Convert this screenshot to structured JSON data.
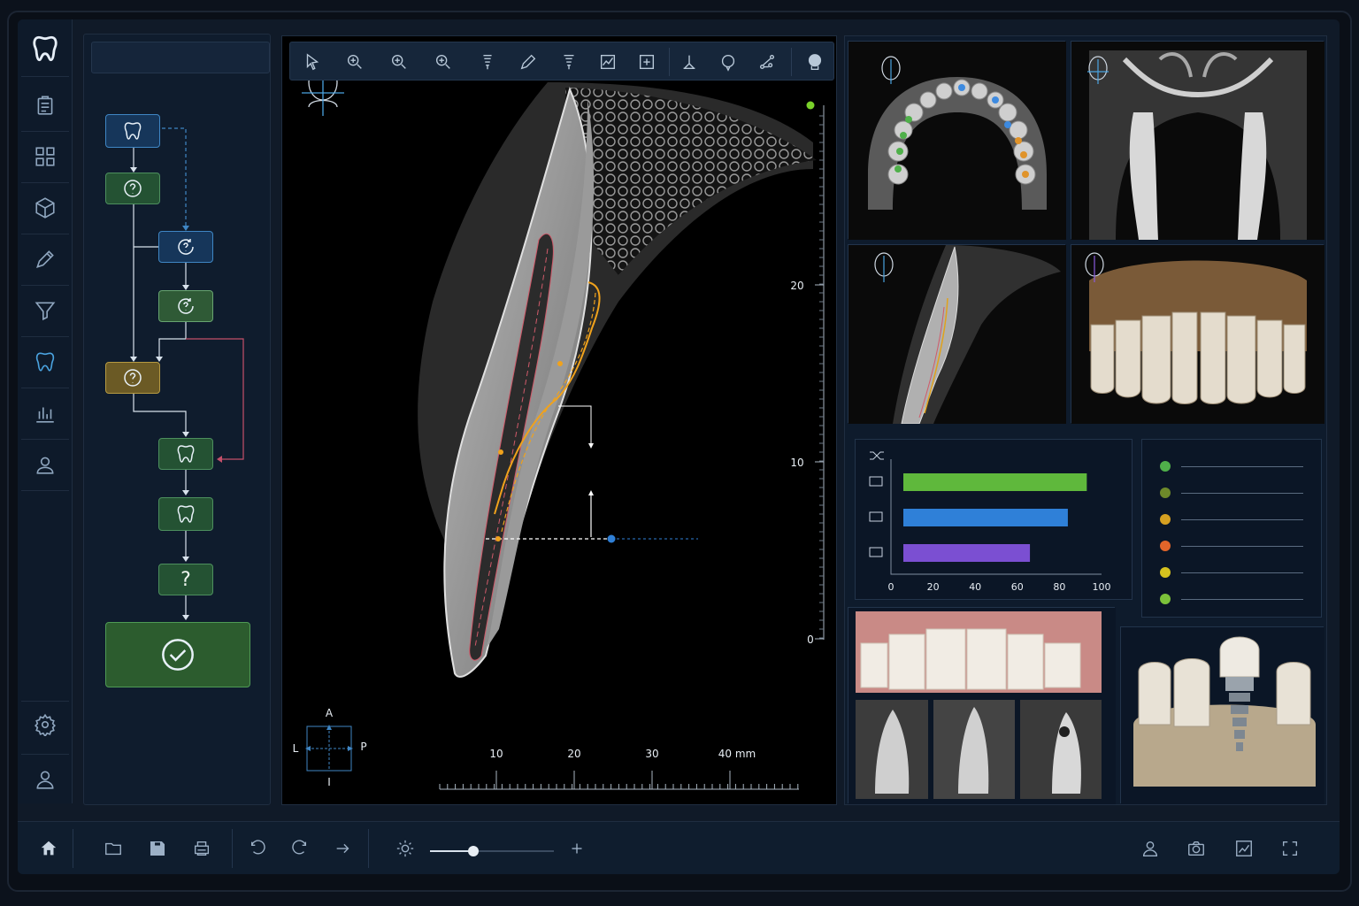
{
  "colors": {
    "accent": "#4aa3e0",
    "workflow_blue": "#3f86c4",
    "workflow_green": "#4d8f5e",
    "workflow_gold": "#b69a42",
    "canal_trace": "#f0a21c",
    "root_outline": "#d05a6a",
    "measure_point": "#2f7fd6"
  },
  "icon_sidebar": {
    "items": [
      "tooth-logo-icon",
      "clipboard-icon",
      "grid-icon",
      "cube-icon",
      "pen-icon",
      "funnel-icon",
      "tooth-icon",
      "bar-chart-icon",
      "user-card-icon",
      "gear-icon",
      "user-icon"
    ],
    "active": "tooth-icon"
  },
  "workflow": {
    "nodes": [
      {
        "icon": "tooth-icon"
      },
      {
        "icon": "question-icon"
      },
      {
        "icon": "rotate-question-icon"
      },
      {
        "icon": "rotate-question-icon"
      },
      {
        "icon": "question-icon"
      },
      {
        "icon": "tooth-icon"
      },
      {
        "icon": "tooth-outline-icon"
      },
      {
        "label": "?"
      },
      {
        "icon": "check-circle-icon"
      }
    ]
  },
  "toolbar": {
    "tools": [
      "pointer-icon",
      "zoom-in-icon",
      "zoom-icon",
      "zoom-alt-icon",
      "implant-icon",
      "pencil-icon",
      "implant-alt-icon",
      "crop-icon",
      "measure-box-icon",
      "tripod-icon",
      "sphere-icon",
      "nodes-icon",
      "head-icon"
    ]
  },
  "main_view": {
    "vertical_scale": {
      "ticks": [
        "20",
        "10",
        "0"
      ]
    },
    "horizontal_scale": {
      "ticks": [
        "10",
        "20",
        "30",
        "40 mm"
      ]
    },
    "orientation": {
      "top": "A",
      "left": "L",
      "right": "P",
      "bottom": "I"
    }
  },
  "chart_data": {
    "type": "bar",
    "orientation": "horizontal",
    "categories": [
      "",
      "",
      ""
    ],
    "values": [
      93,
      84,
      66
    ],
    "colors": [
      "#5fb83c",
      "#2f80d8",
      "#7b4fd2"
    ],
    "xlim": [
      0,
      100
    ],
    "xticks": [
      "0",
      "20",
      "40",
      "60",
      "80",
      "100"
    ],
    "title": "",
    "xlabel": "",
    "ylabel": ""
  },
  "legend": {
    "dots": [
      "#4fb04a",
      "#6e8a2a",
      "#d6a021",
      "#e2652a",
      "#d6c21e",
      "#7cc23a"
    ]
  },
  "bottom_toolbar": {
    "left": [
      "home-icon",
      "folder-icon",
      "save-icon",
      "print-icon"
    ],
    "edit": [
      "undo-icon",
      "redo-icon",
      "forward-icon"
    ],
    "brightness_value": 0.35,
    "right": [
      "user-icon",
      "camera-icon",
      "export-image-icon",
      "fullscreen-icon"
    ]
  }
}
